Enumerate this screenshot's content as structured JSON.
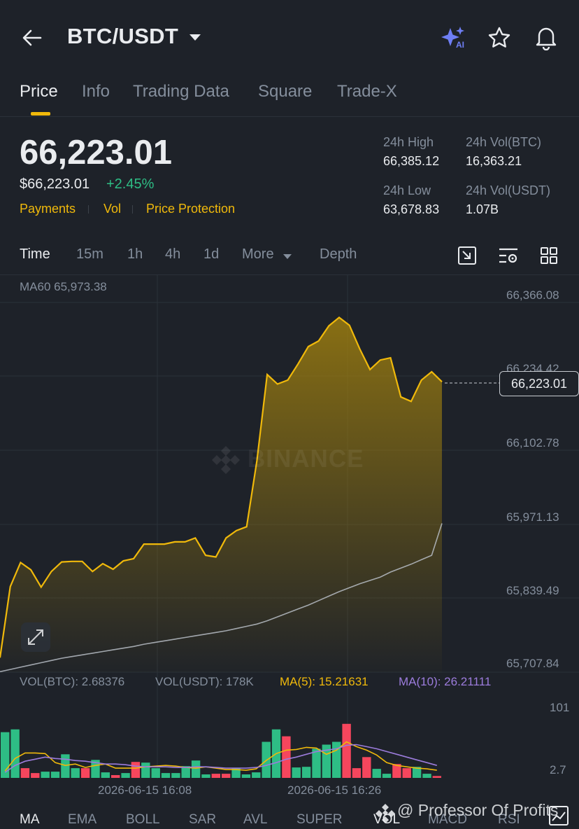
{
  "header": {
    "pair": "BTC/USDT",
    "ai_label": "AI"
  },
  "tabs": [
    "Price",
    "Info",
    "Trading Data",
    "Square",
    "Trade-X"
  ],
  "price": {
    "last": "66,223.01",
    "usd": "$66,223.01",
    "change": "+2.45%",
    "links": [
      "Payments",
      "Vol",
      "Price Protection"
    ]
  },
  "stats": {
    "high_label": "24h High",
    "high_value": "66,385.12",
    "volbtc_label": "24h Vol(BTC)",
    "volbtc_value": "16,363.21",
    "low_label": "24h Low",
    "low_value": "63,678.83",
    "volusdt_label": "24h Vol(USDT)",
    "volusdt_value": "1.07B"
  },
  "timeframes": [
    "Time",
    "15m",
    "1h",
    "4h",
    "1d",
    "More",
    "Depth"
  ],
  "chart": {
    "ma60_label": "MA60 65,973.38",
    "y_labels": [
      "66,366.08",
      "66,234.42",
      "66,102.78",
      "65,971.13",
      "65,839.49",
      "65,707.84"
    ],
    "current_price_tag": "66,223.01",
    "watermark": "BINANCE",
    "vol_labels": {
      "vol_btc": "VOL(BTC): 2.68376",
      "vol_usdt": "VOL(USDT): 178K",
      "ma5": "MA(5): 15.21631",
      "ma10": "MA(10): 26.21111"
    },
    "vol_y_labels": [
      "101",
      "2.7"
    ],
    "dates": [
      "2026-06-15 16:08",
      "2026-06-15 16:26"
    ]
  },
  "indicators": [
    "MA",
    "EMA",
    "BOLL",
    "SAR",
    "AVL",
    "SUPER",
    "VOL",
    "MACD",
    "RSI"
  ],
  "credit": "@ Professor Of Profits",
  "colors": {
    "accent": "#f0b90b",
    "up": "#2ebd85",
    "down": "#f6465d",
    "bg": "#1e2229",
    "ma10": "#9c7cdc",
    "ma60": "#b7bdc6"
  },
  "chart_data": {
    "type": "line",
    "x": [
      "2026-06-15 16:08",
      "2026-06-15 16:26"
    ],
    "price_ylim": [
      65707.84,
      66366.08
    ],
    "price_series": [
      65730,
      65857,
      65900,
      65887,
      65856,
      65884,
      65901,
      65902,
      65902,
      65884,
      65898,
      65888,
      65903,
      65907,
      65933,
      65933,
      65933,
      65937,
      65937,
      65944,
      65913,
      65910,
      65944,
      65957,
      65964,
      66082,
      66236,
      66219,
      66226,
      66255,
      66286,
      66296,
      66323,
      66338,
      66324,
      66282,
      66245,
      66262,
      66266,
      66196,
      66188,
      66226,
      66241,
      66223
    ],
    "ma60_series": [
      65705,
      65709,
      65713,
      65717,
      65721,
      65725,
      65729,
      65732,
      65735,
      65738,
      65741,
      65744,
      65747,
      65750,
      65754,
      65757,
      65760,
      65763,
      65766,
      65769,
      65772,
      65775,
      65778,
      65782,
      65786,
      65790,
      65796,
      65803,
      65810,
      65817,
      65824,
      65832,
      65840,
      65848,
      65855,
      65862,
      65868,
      65874,
      65883,
      65890,
      65897,
      65905,
      65913,
      65970
    ],
    "volume": [
      {
        "v": 66,
        "up": true
      },
      {
        "v": 70,
        "up": true
      },
      {
        "v": 14,
        "up": false
      },
      {
        "v": 7,
        "up": false
      },
      {
        "v": 9,
        "up": true
      },
      {
        "v": 9,
        "up": true
      },
      {
        "v": 34,
        "up": true
      },
      {
        "v": 14,
        "up": true
      },
      {
        "v": 14,
        "up": false
      },
      {
        "v": 26,
        "up": true
      },
      {
        "v": 8,
        "up": true
      },
      {
        "v": 4,
        "up": false
      },
      {
        "v": 7,
        "up": true
      },
      {
        "v": 23,
        "up": false
      },
      {
        "v": 22,
        "up": true
      },
      {
        "v": 14,
        "up": true
      },
      {
        "v": 7,
        "up": true
      },
      {
        "v": 7,
        "up": true
      },
      {
        "v": 17,
        "up": true
      },
      {
        "v": 25,
        "up": true
      },
      {
        "v": 5,
        "up": true
      },
      {
        "v": 6,
        "up": false
      },
      {
        "v": 6,
        "up": false
      },
      {
        "v": 14,
        "up": true
      },
      {
        "v": 5,
        "up": true
      },
      {
        "v": 8,
        "up": true
      },
      {
        "v": 52,
        "up": true
      },
      {
        "v": 70,
        "up": true
      },
      {
        "v": 60,
        "up": false
      },
      {
        "v": 15,
        "up": true
      },
      {
        "v": 16,
        "up": true
      },
      {
        "v": 42,
        "up": true
      },
      {
        "v": 48,
        "up": true
      },
      {
        "v": 52,
        "up": true
      },
      {
        "v": 78,
        "up": false
      },
      {
        "v": 14,
        "up": false
      },
      {
        "v": 30,
        "up": false
      },
      {
        "v": 13,
        "up": true
      },
      {
        "v": 6,
        "up": true
      },
      {
        "v": 20,
        "up": false
      },
      {
        "v": 14,
        "up": false
      },
      {
        "v": 16,
        "up": true
      },
      {
        "v": 6,
        "up": true
      },
      {
        "v": 2.7,
        "up": false
      }
    ],
    "vol_ma5": [
      10,
      28,
      36,
      36,
      35,
      22,
      18,
      20,
      15,
      18,
      20,
      14,
      14,
      14,
      16,
      17,
      18,
      17,
      15,
      14,
      16,
      14,
      12,
      12,
      11,
      13,
      25,
      35,
      40,
      41,
      44,
      43,
      34,
      40,
      52,
      45,
      40,
      33,
      22,
      18,
      16,
      14,
      13,
      11
    ],
    "vol_ma10": [
      8,
      18,
      24,
      27,
      30,
      28,
      27,
      25,
      24,
      22,
      20,
      20,
      19,
      17,
      16,
      16,
      16,
      15,
      15,
      16,
      16,
      15,
      14,
      14,
      14,
      15,
      18,
      22,
      27,
      30,
      34,
      38,
      40,
      42,
      47,
      48,
      45,
      42,
      38,
      34,
      30,
      26,
      22,
      18
    ],
    "vol_ylim": [
      0,
      101
    ]
  }
}
